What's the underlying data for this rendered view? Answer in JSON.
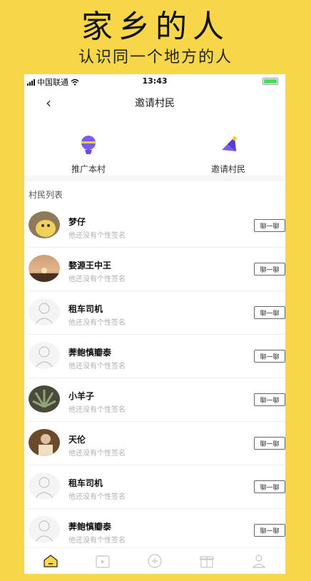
{
  "promo": {
    "title": "家乡的人",
    "subtitle": "认识同一个地方的人"
  },
  "status_bar": {
    "carrier": "中国联通",
    "time": "13:43"
  },
  "nav": {
    "title": "邀请村民",
    "back_icon": "chevron-left-icon"
  },
  "actions": [
    {
      "label": "推广本村",
      "icon": "balloon-icon"
    },
    {
      "label": "邀请村民",
      "icon": "megaphone-icon"
    }
  ],
  "section_title": "村民列表",
  "chat_label": "聊一聊",
  "villagers": [
    {
      "name": "梦仔",
      "signature": "他还没有个性签名",
      "avatar": "photo-pikachu"
    },
    {
      "name": "婺源王中王",
      "signature": "他还没有个性签名",
      "avatar": "photo-sunset"
    },
    {
      "name": "租车司机",
      "signature": "他还没有个性签名",
      "avatar": "default-person"
    },
    {
      "name": "莾鲍慎瓣泰",
      "signature": "他还没有个性签名",
      "avatar": "default-person"
    },
    {
      "name": "小羊子",
      "signature": "他还没有个性签名",
      "avatar": "photo-succulent"
    },
    {
      "name": "天伦",
      "signature": "他还没有个性签名",
      "avatar": "photo-portrait"
    },
    {
      "name": "租车司机",
      "signature": "他还没有个性签名",
      "avatar": "default-person"
    },
    {
      "name": "莾鲍慎瓣泰",
      "signature": "他还没有个性签名",
      "avatar": "default-person"
    }
  ],
  "tabs": [
    {
      "icon": "home-icon",
      "active": true
    },
    {
      "icon": "calendar-icon",
      "active": false
    },
    {
      "icon": "add-circle-icon",
      "active": false
    },
    {
      "icon": "gift-icon",
      "active": false
    },
    {
      "icon": "profile-icon",
      "active": false
    }
  ],
  "colors": {
    "background": "#F8D64A",
    "accent_purple": "#7B5CF0",
    "battery": "#4CD964"
  }
}
